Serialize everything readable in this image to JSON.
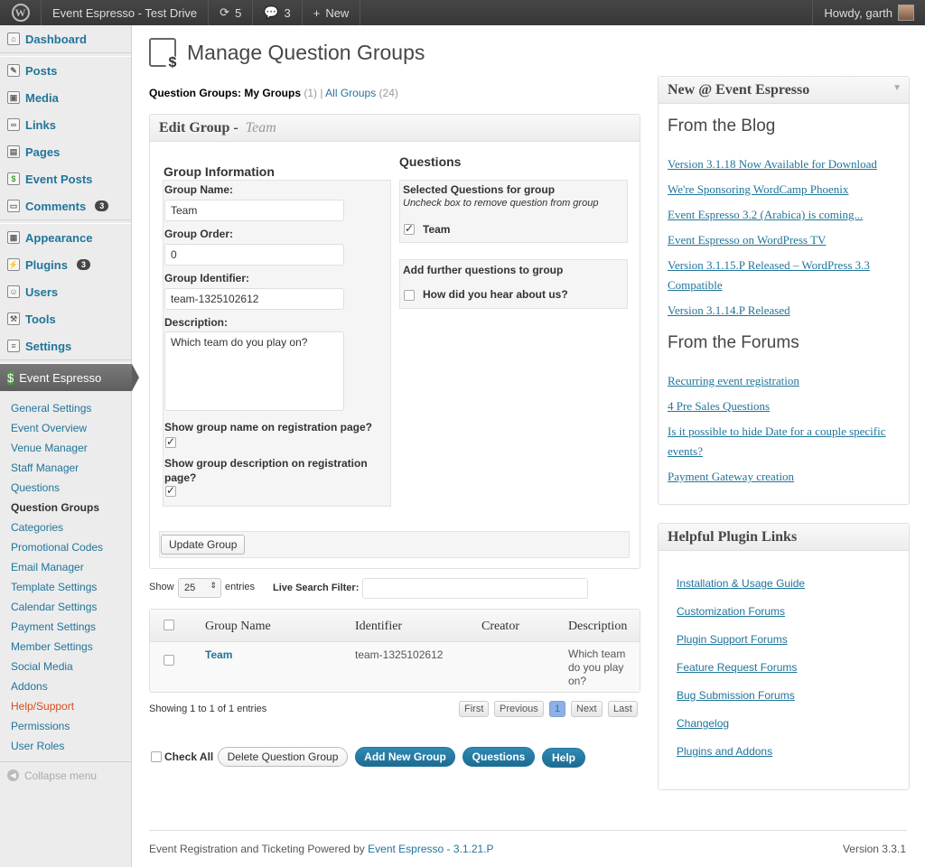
{
  "adminbar": {
    "site": "Event Espresso - Test Drive",
    "updates": "5",
    "comments": "3",
    "new": "New",
    "howdy": "Howdy, garth"
  },
  "sidebar": {
    "items": [
      "Dashboard",
      "Posts",
      "Media",
      "Links",
      "Pages",
      "Event Posts",
      "Comments",
      "Appearance",
      "Plugins",
      "Users",
      "Tools",
      "Settings"
    ],
    "comments_badge": "3",
    "plugins_badge": "3",
    "ee": "Event Espresso",
    "submenu": [
      "General Settings",
      "Event Overview",
      "Venue Manager",
      "Staff Manager",
      "Questions",
      "Question Groups",
      "Categories",
      "Promotional Codes",
      "Email Manager",
      "Template Settings",
      "Calendar Settings",
      "Payment Settings",
      "Member Settings",
      "Social Media",
      "Addons",
      "Help/Support",
      "Permissions",
      "User Roles"
    ],
    "collapse": "Collapse menu"
  },
  "page": {
    "title": "Manage Question Groups",
    "filter_label": "Question Groups:",
    "my_groups": "My Groups",
    "my_count": "(1)",
    "sep": "|",
    "all_groups": "All Groups",
    "all_count": "(24)"
  },
  "edit": {
    "heading": "Edit Group -",
    "group": "Team",
    "info_title": "Group Information",
    "name_label": "Group Name:",
    "name_value": "Team",
    "order_label": "Group Order:",
    "order_value": "0",
    "ident_label": "Group Identifier:",
    "ident_value": "team-1325102612",
    "desc_label": "Description:",
    "desc_value": "Which team do you play on?",
    "show_name": "Show group name on registration page?",
    "show_desc": "Show group description on registration page?",
    "update": "Update Group",
    "questions_title": "Questions",
    "selected_title": "Selected Questions for group",
    "selected_hint": "Uncheck box to remove question from group",
    "selected_q": "Team",
    "further_title": "Add further questions to group",
    "further_q": "How did you hear about us?"
  },
  "table": {
    "show": "Show",
    "entries_value": "25",
    "entries": "entries",
    "search_label": "Live Search Filter:",
    "headers": [
      "Group Name",
      "Identifier",
      "Creator",
      "Description"
    ],
    "row": {
      "name": "Team",
      "identifier": "team-1325102612",
      "creator": "",
      "description": "Which team do you play on?"
    },
    "info": "Showing 1 to 1 of 1 entries",
    "pager": [
      "First",
      "Previous",
      "1",
      "Next",
      "Last"
    ]
  },
  "actions": {
    "check_all": "Check All",
    "delete": "Delete Question Group",
    "add": "Add New Group",
    "questions": "Questions",
    "help": "Help"
  },
  "footer": {
    "text": "Event Registration and Ticketing Powered by",
    "link": "Event Espresso - 3.1.21.P",
    "version": "Version 3.3.1"
  },
  "news": {
    "title": "New @ Event Espresso",
    "blog_title": "From the Blog",
    "blog": [
      "Version 3.1.18 Now Available for Download",
      "We're Sponsoring WordCamp Phoenix",
      "Event Espresso 3.2 (Arabica) is coming...",
      "Event Espresso on WordPress TV",
      "Version 3.1.15.P Released – WordPress 3.3 Compatible",
      "Version 3.1.14.P Released"
    ],
    "forum_title": "From the Forums",
    "forums": [
      "Recurring event registration",
      "4 Pre Sales Questions",
      "Is it possible to hide Date for a couple specific events?",
      "Payment Gateway creation"
    ]
  },
  "helpful": {
    "title": "Helpful Plugin Links",
    "links": [
      "Installation & Usage Guide",
      "Customization Forums",
      "Plugin Support Forums",
      "Feature Request Forums",
      "Bug Submission Forums",
      "Changelog",
      "Plugins and Addons"
    ]
  }
}
